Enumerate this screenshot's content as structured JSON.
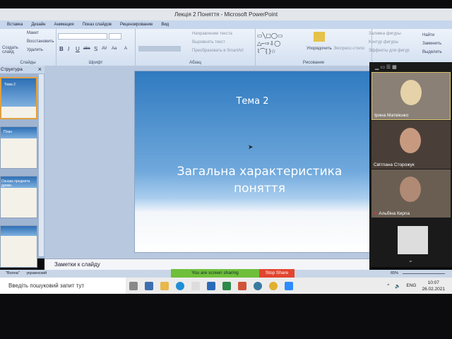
{
  "window": {
    "title": "Лекція 2 Поняття - Microsoft PowerPoint"
  },
  "tabs": [
    "Вставка",
    "Дизайн",
    "Анимация",
    "Показ слайдов",
    "Рецензирование",
    "Вид"
  ],
  "ribbon": {
    "slides": {
      "label": "Слайды",
      "create": "Создать слайд",
      "layout": "Макет",
      "reset": "Восстановить",
      "delete": "Удалить"
    },
    "font": {
      "label": "Шрифт",
      "bold": "B",
      "italic": "I",
      "underline": "U",
      "strike": "abc",
      "shadow": "S",
      "spacing": "AV",
      "case": "Aa",
      "color": "A"
    },
    "paragraph": {
      "label": "Абзац",
      "text_direction": "Направление текста",
      "align_text": "Выровнять текст",
      "smartart": "Преобразовать в SmartArt"
    },
    "drawing": {
      "label": "Рисование",
      "arrange": "Упорядочить",
      "quick_styles": "Экспресс-стили",
      "fill": "Заливка фигуры",
      "outline": "Контур фигуры",
      "effects": "Эффекты для фигур"
    },
    "editing": {
      "find": "Найти",
      "replace": "Заменить",
      "select": "Выделить"
    }
  },
  "left_pane": {
    "tab": "Структура",
    "close": "×",
    "thumbs": [
      "Тема 2",
      "План",
      "Ознака предмета думки.",
      ""
    ]
  },
  "slide": {
    "title": "Тема 2",
    "subtitle": "Загальна характеристика поняття"
  },
  "notes": {
    "placeholder": "Заметки к слайду"
  },
  "status": {
    "theme": "\"Волна\"",
    "language": "украинский",
    "zoom": "65%"
  },
  "sharing": {
    "message": "You are screen sharing",
    "stop": "Stop Share"
  },
  "participants": [
    "Ірина Матвієнко",
    "Світлана Сторожук",
    "Альбіна Кирпа"
  ],
  "taskbar": {
    "search_placeholder": "Введіть пошуковий запит тут",
    "lang": "ENG",
    "time": "10:07",
    "date": "26.02.2021"
  }
}
